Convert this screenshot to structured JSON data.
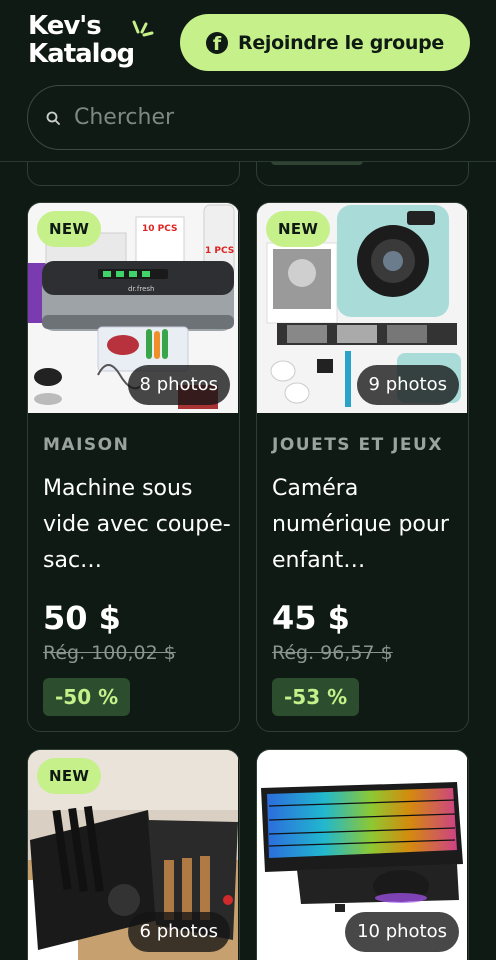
{
  "header": {
    "logo_line1": "Kev's",
    "logo_line2": "Katalog",
    "join_button_label": "Rejoindre le groupe"
  },
  "search": {
    "placeholder": "Chercher"
  },
  "colors": {
    "background": "#0f1a14",
    "accent": "#c5f08a",
    "discount_bg": "#2c4d2e"
  },
  "products": [
    {
      "badge": "NEW",
      "photos": "8 photos",
      "category": "MAISON",
      "title": "Machine sous vide avec coupe-sac…",
      "price": "50 $",
      "regular_price": "Rég. 100,02 $",
      "discount": "-50 %"
    },
    {
      "badge": "NEW",
      "photos": "9 photos",
      "category": "JOUETS ET JEUX",
      "title": "Caméra numérique pour enfant…",
      "price": "45 $",
      "regular_price": "Rég. 96,57 $",
      "discount": "-53 %"
    },
    {
      "badge": "NEW",
      "photos": "6 photos"
    },
    {
      "photos": "10 photos"
    }
  ],
  "image_labels": {
    "vacuum_brand": "dr.fresh",
    "vacuum_box1": "10 PCS",
    "vacuum_box2": "1 PCS"
  }
}
